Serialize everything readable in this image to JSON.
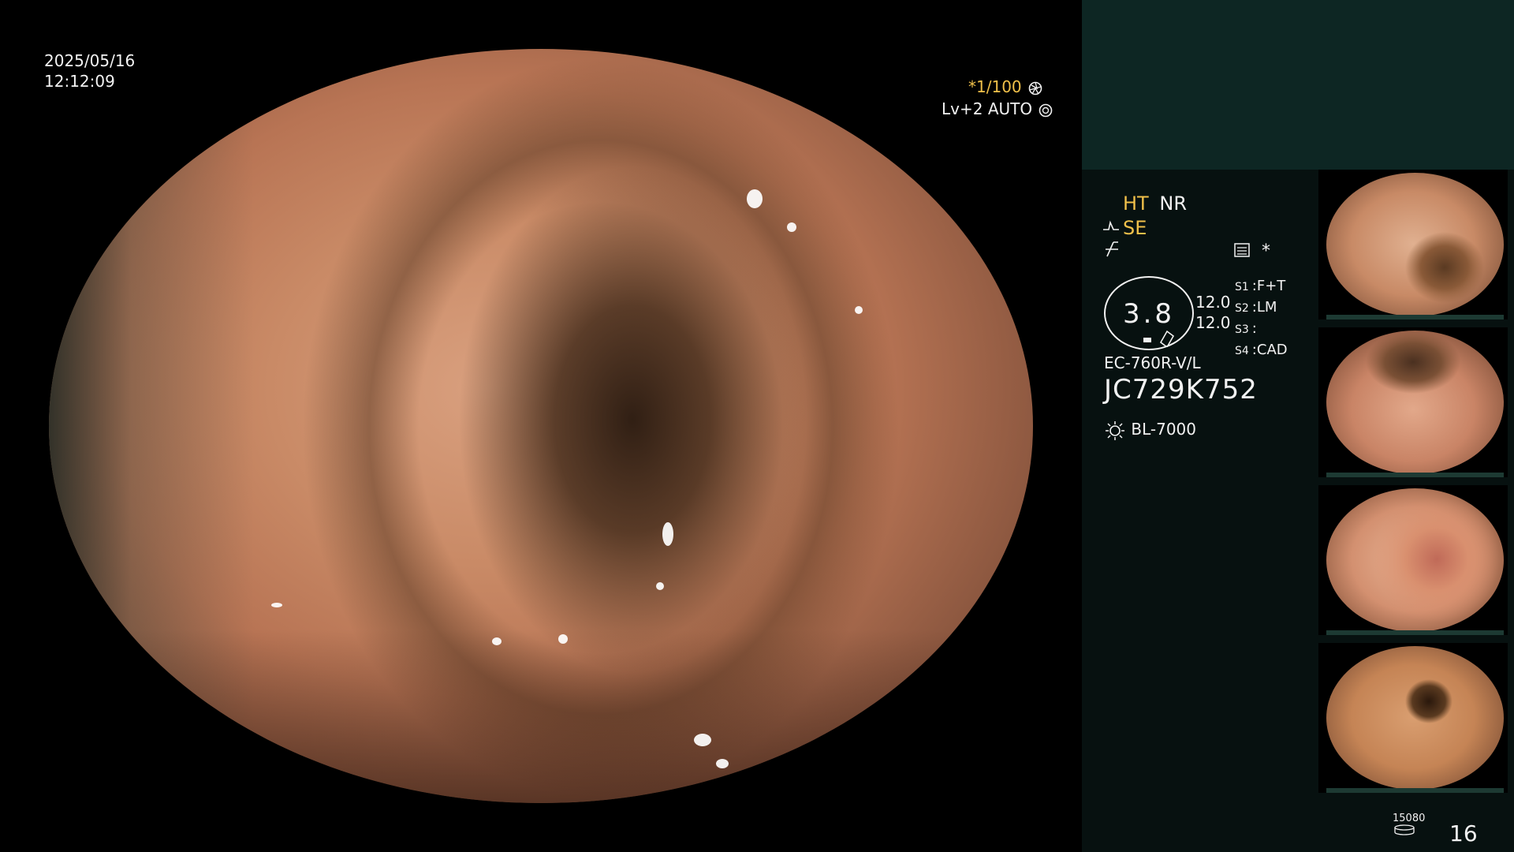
{
  "overlay": {
    "date": "2025/05/16",
    "time": "12:12:09",
    "shutter": "*1/100",
    "level": "Lv+2 AUTO"
  },
  "panel": {
    "ht": "HT",
    "nr": "NR",
    "se": "SE",
    "star": "*",
    "gauge_value": "3.8",
    "gauge_vals": [
      "12.0",
      "12.0"
    ],
    "s_labels": [
      {
        "key": "S1",
        "value": "F+T"
      },
      {
        "key": "S2",
        "value": "LM"
      },
      {
        "key": "S3",
        "value": ""
      },
      {
        "key": "S4",
        "value": "CAD"
      }
    ],
    "scope_model": "EC-760R-V/L",
    "serial": "JC729K752",
    "light_source": "BL-7000",
    "storage_count": "15080",
    "page_number": "16"
  },
  "thumbnails": [
    {
      "name": "capture-1"
    },
    {
      "name": "capture-2"
    },
    {
      "name": "capture-3"
    },
    {
      "name": "capture-4"
    }
  ],
  "colors": {
    "accent_yellow": "#f0c04a",
    "panel_bg": "#071110",
    "panel_top_band": "#0d2623",
    "mucosa": "#c98a66"
  }
}
